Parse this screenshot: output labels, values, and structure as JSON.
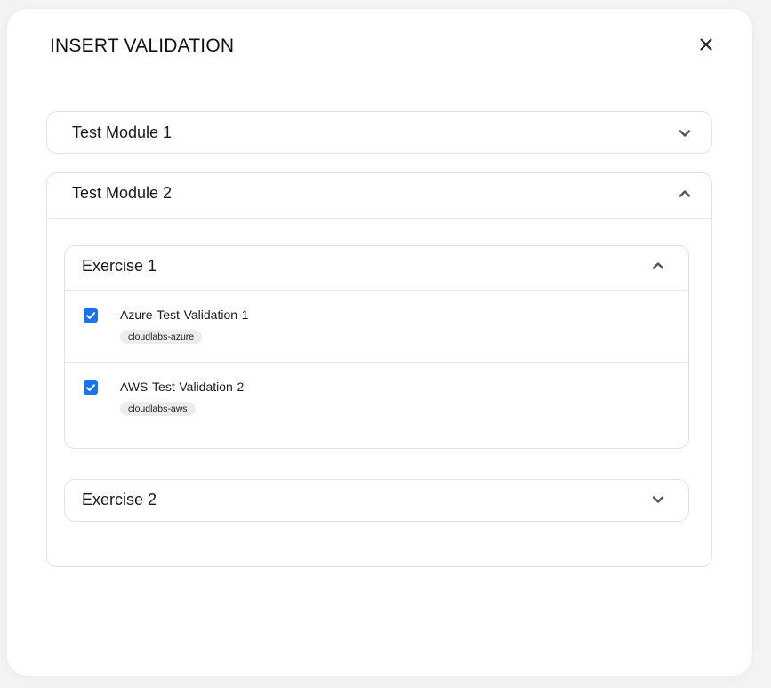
{
  "dialog": {
    "title": "INSERT VALIDATION"
  },
  "modules": [
    {
      "label": "Test Module 1",
      "expanded": false
    },
    {
      "label": "Test Module 2",
      "expanded": true,
      "exercises": [
        {
          "label": "Exercise 1",
          "expanded": true,
          "validations": [
            {
              "name": "Azure-Test-Validation-1",
              "tag": "cloudlabs-azure",
              "checked": true
            },
            {
              "name": "AWS-Test-Validation-2",
              "tag": "cloudlabs-aws",
              "checked": true
            }
          ]
        },
        {
          "label": "Exercise 2",
          "expanded": false
        }
      ]
    }
  ],
  "colors": {
    "accent": "#1a73e8",
    "border": "#e2e2e2",
    "tag_bg": "#ececec"
  },
  "icons": {
    "close": "close-icon",
    "collapsed": "chevron-down-icon",
    "expanded": "chevron-up-icon",
    "checked": "checkmark-icon"
  }
}
